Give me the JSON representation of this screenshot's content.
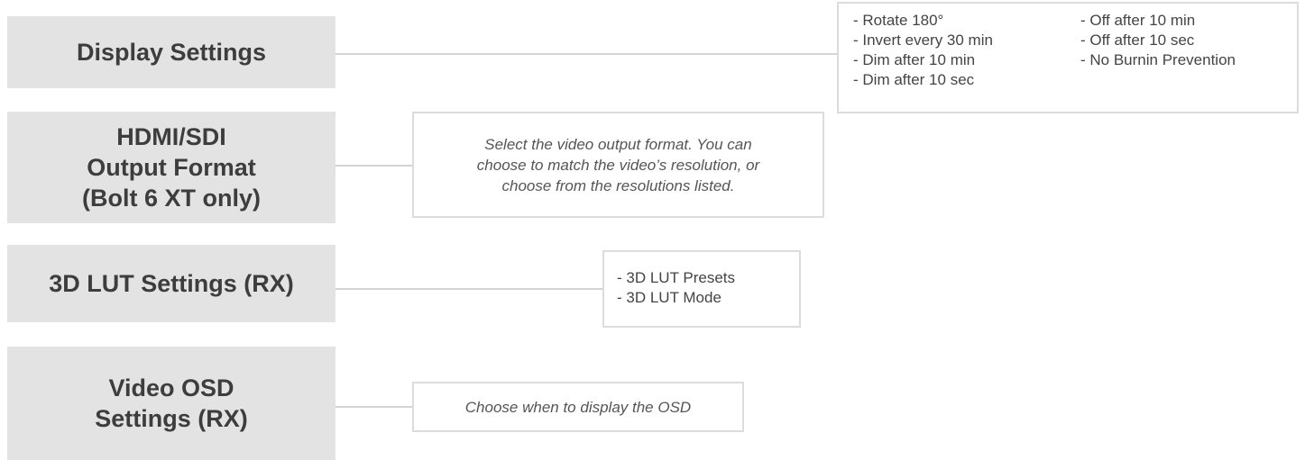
{
  "sections": [
    {
      "label_lines": [
        "Display Settings"
      ]
    },
    {
      "label_lines": [
        "HDMI/SDI",
        "Output Format",
        "(Bolt 6 XT only)"
      ]
    },
    {
      "label_lines": [
        "3D LUT Settings (RX)"
      ]
    },
    {
      "label_lines": [
        "Video OSD",
        "Settings (RX)"
      ]
    }
  ],
  "display_settings_options": {
    "left": [
      "- Rotate 180°",
      "- Invert every 30 min",
      "- Dim after 10 min",
      "- Dim after 10 sec"
    ],
    "right": [
      "- Off after 10 min",
      "- Off after 10 sec",
      "- No Burnin Prevention"
    ]
  },
  "hdmi_description": [
    "Select the video output format. You can",
    "choose to match the video’s resolution, or",
    "choose from the resolutions listed."
  ],
  "lut_options": [
    "- 3D LUT Presets",
    "- 3D LUT Mode"
  ],
  "osd_description": "Choose when to display the OSD",
  "colors": {
    "box_fill": "#e3e3e3",
    "connector": "#d4d4d4",
    "border": "#dcdcdc"
  }
}
